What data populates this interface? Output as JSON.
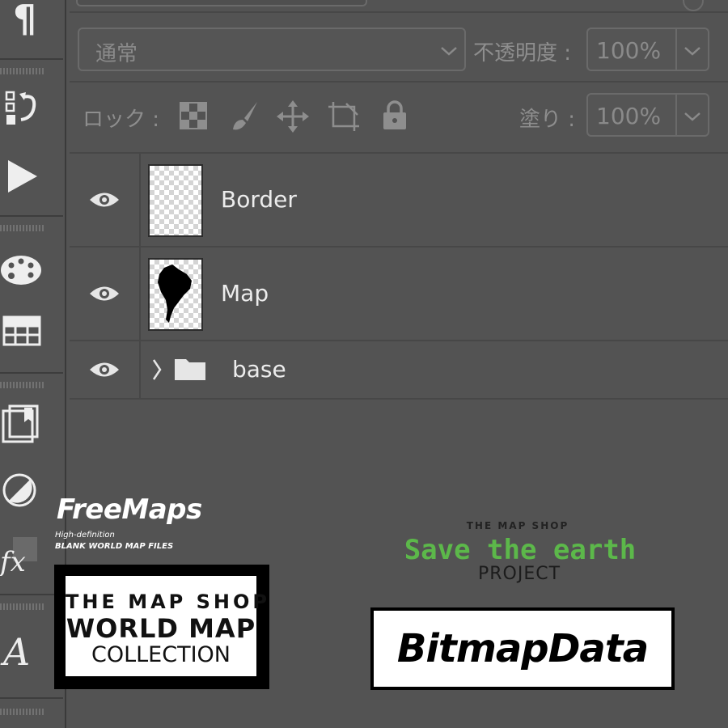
{
  "tools": {
    "paragraph": "¶"
  },
  "layers_panel": {
    "blend_mode": "通常",
    "opacity_label": "不透明度 :",
    "opacity_value": "100%",
    "lock_label": "ロック :",
    "fill_label": "塗り :",
    "fill_value": "100%",
    "layers": [
      {
        "name": "Border",
        "visible": true,
        "thumbnail": "transparent-checker"
      },
      {
        "name": "Map",
        "visible": true,
        "thumbnail": "south-america-silhouette"
      },
      {
        "name": "base",
        "visible": true,
        "type": "group",
        "collapsed": true
      }
    ]
  },
  "branding": {
    "freemaps_title": "FreeMaps",
    "freemaps_sub1": "High-definition",
    "freemaps_sub2": "BLANK WORLD MAP FILES",
    "collection_line1": "THE MAP SHOP",
    "collection_line2": "WORLD MAP",
    "collection_line3": "COLLECTION",
    "stamp_small": "THE MAP SHOP",
    "stamp_green": "Save the earth",
    "stamp_project": "PROJECT",
    "bitmap_label": "BitmapData"
  },
  "colors": {
    "background": "#535353",
    "accent_green": "#5cb84a"
  }
}
